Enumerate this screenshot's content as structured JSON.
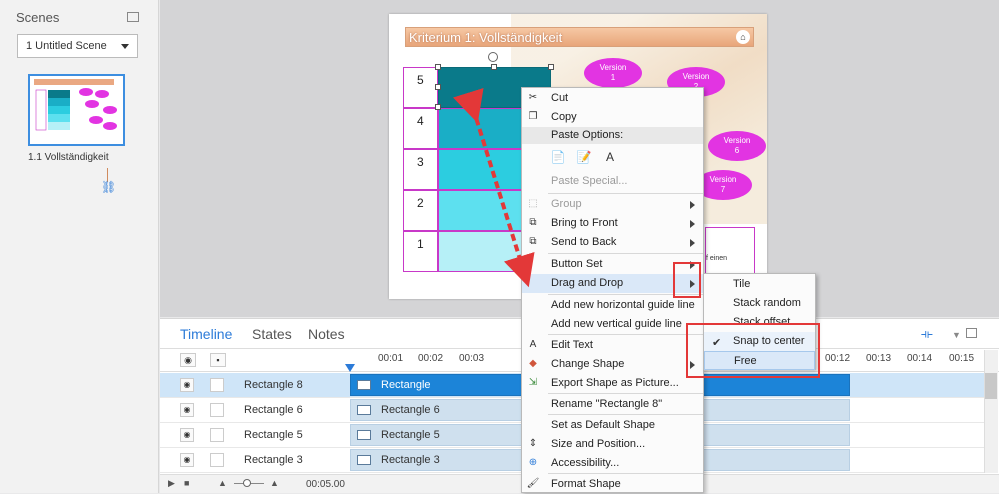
{
  "scenes": {
    "title": "Scenes",
    "selected_scene": "1 Untitled Scene",
    "thumb_caption": "1.1 Vollständigkeit"
  },
  "slide": {
    "title": "Kriterium 1: Vollständigkeit",
    "rows": [
      "5",
      "4",
      "3",
      "2",
      "1"
    ],
    "versions": [
      {
        "label": "Version\n1"
      },
      {
        "label": "Version\n2"
      },
      {
        "label": "Version\n6"
      },
      {
        "label": "Version\n7"
      }
    ],
    "text_tail": "f einen",
    "bar_colors": [
      "#0a7a8a",
      "#1aaec6",
      "#2ccde0",
      "#5de0ef",
      "#b6f0f7"
    ]
  },
  "timeline": {
    "tabs": [
      "Timeline",
      "States",
      "Notes"
    ],
    "ticks": [
      "00:01",
      "00:02",
      "00:03",
      "00:12",
      "00:13",
      "00:14",
      "00:15"
    ],
    "rows": [
      {
        "name": "Rectangle 8",
        "clip": "Rectangle"
      },
      {
        "name": "Rectangle 6",
        "clip": "Rectangle 6"
      },
      {
        "name": "Rectangle 5",
        "clip": "Rectangle 5"
      },
      {
        "name": "Rectangle 3",
        "clip": "Rectangle 3"
      }
    ],
    "duration": "00:05.00"
  },
  "context_menu": {
    "cut": "Cut",
    "copy": "Copy",
    "paste_options": "Paste Options:",
    "paste_special": "Paste Special...",
    "group": "Group",
    "bring_to_front": "Bring to Front",
    "send_to_back": "Send to Back",
    "button_set": "Button Set",
    "drag_and_drop": "Drag and Drop",
    "add_h_guide": "Add new horizontal guide line",
    "add_v_guide": "Add new vertical guide line",
    "edit_text": "Edit Text",
    "change_shape": "Change Shape",
    "export_shape": "Export Shape as Picture...",
    "rename": "Rename \"Rectangle 8\"",
    "set_default": "Set as Default Shape",
    "size_position": "Size and Position...",
    "accessibility": "Accessibility...",
    "format_shape": "Format Shape"
  },
  "submenu": {
    "tile": "Tile",
    "stack_random": "Stack random",
    "stack_offset": "Stack offset",
    "snap_to_center": "Snap to center",
    "free": "Free"
  },
  "colors": {
    "accent": "#2c7bd8",
    "annotation": "#e33838",
    "magenta": "#c838c8"
  }
}
